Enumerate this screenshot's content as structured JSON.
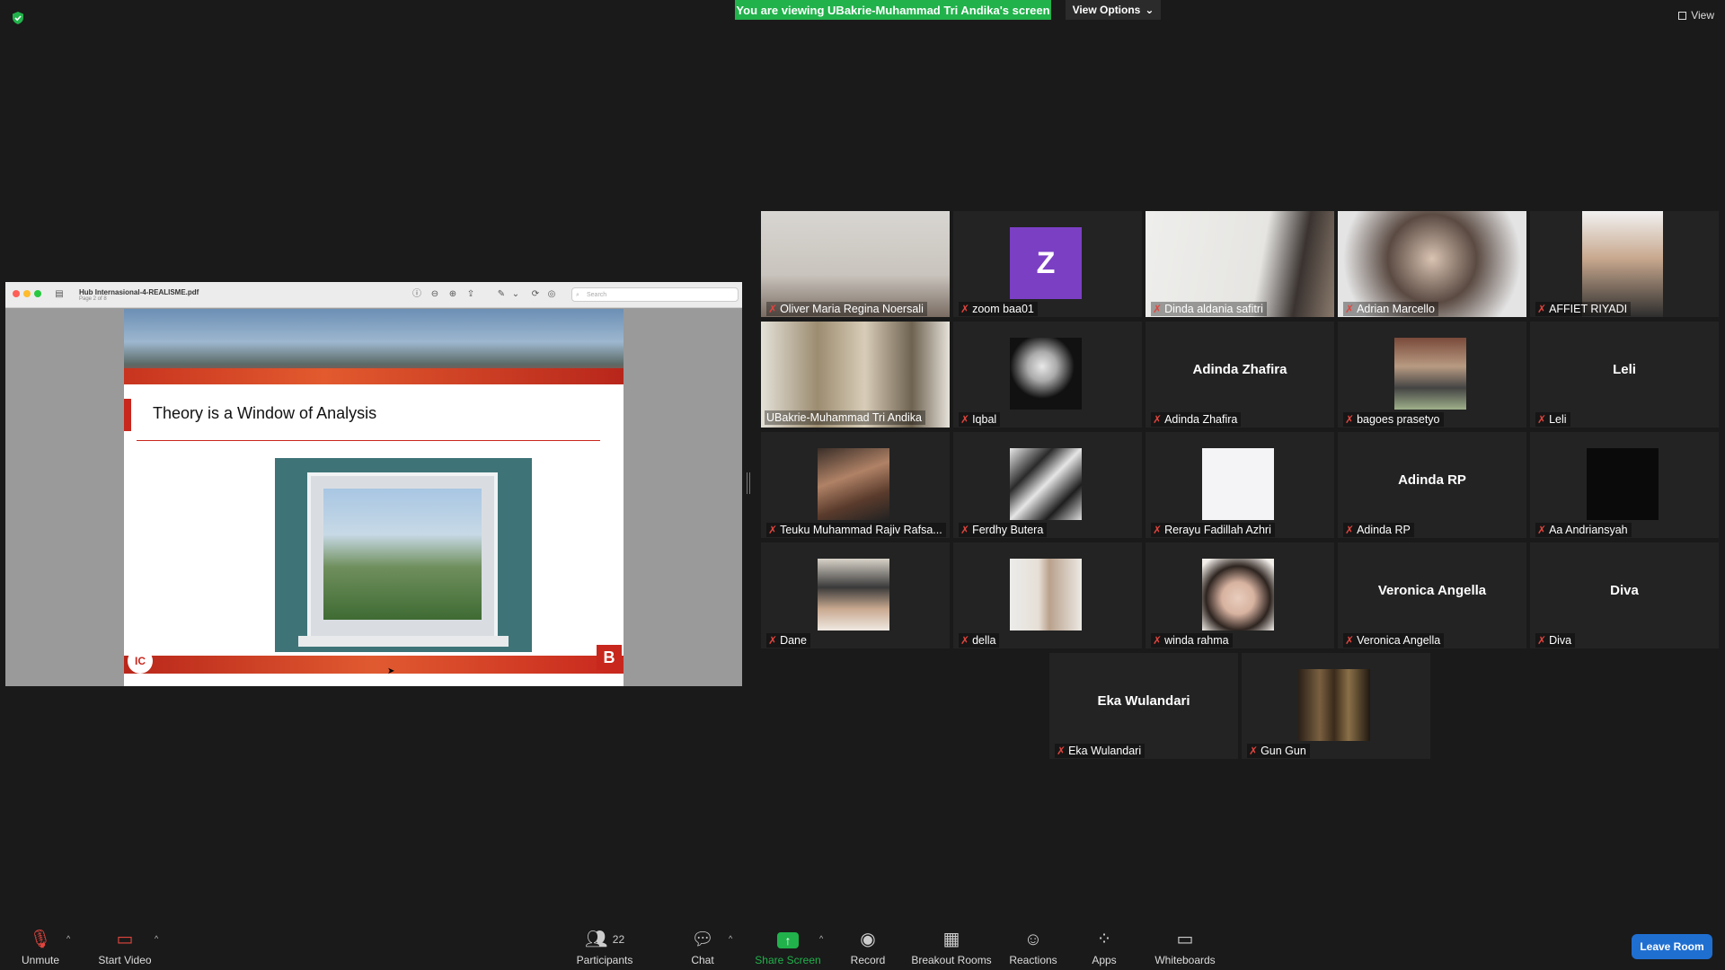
{
  "top": {
    "share_banner": "You are viewing UBakrie-Muhammad Tri Andika's screen",
    "view_options": "View Options",
    "view_toggle": "View"
  },
  "shared_screen": {
    "pdf_title": "Hub Internasional-4-REALISME.pdf",
    "pdf_subtitle": "Page 2 of 8",
    "search_placeholder": "Search",
    "slide_title": "Theory is a Window of Analysis",
    "slide_logo_left": "IC",
    "slide_logo_right": "B"
  },
  "participants": [
    {
      "name": "Oliver Maria Regina Noersali",
      "muted": true,
      "display": "video"
    },
    {
      "name": "zoom baa01",
      "muted": true,
      "display": "avatar",
      "avatar_letter": "Z"
    },
    {
      "name": "Dinda aldania safitri",
      "muted": true,
      "display": "video"
    },
    {
      "name": "Adrian Marcello",
      "muted": true,
      "display": "video"
    },
    {
      "name": "AFFIET RIYADI",
      "muted": true,
      "display": "video"
    },
    {
      "name": "UBakrie-Muhammad Tri Andika",
      "muted": false,
      "display": "video",
      "active_speaker": true
    },
    {
      "name": "Iqbal",
      "muted": true,
      "display": "photo"
    },
    {
      "name": "Adinda Zhafira",
      "muted": true,
      "display": "name"
    },
    {
      "name": "bagoes prasetyo",
      "muted": true,
      "display": "photo"
    },
    {
      "name": "Leli",
      "muted": true,
      "display": "name"
    },
    {
      "name": "Teuku Muhammad Rajiv Rafsa...",
      "muted": true,
      "display": "photo"
    },
    {
      "name": "Ferdhy Butera",
      "muted": true,
      "display": "photo"
    },
    {
      "name": "Rerayu Fadillah Azhri",
      "muted": true,
      "display": "photo"
    },
    {
      "name": "Adinda RP",
      "muted": true,
      "display": "name"
    },
    {
      "name": "Aa Andriansyah",
      "muted": true,
      "display": "photo"
    },
    {
      "name": "Dane",
      "muted": true,
      "display": "photo"
    },
    {
      "name": "della",
      "muted": true,
      "display": "photo"
    },
    {
      "name": "winda rahma",
      "muted": true,
      "display": "photo"
    },
    {
      "name": "Veronica Angella",
      "muted": true,
      "display": "name"
    },
    {
      "name": "Diva",
      "muted": true,
      "display": "name"
    },
    {
      "name": "Eka Wulandari",
      "muted": true,
      "display": "name"
    },
    {
      "name": "Gun Gun",
      "muted": true,
      "display": "photo"
    }
  ],
  "toolbar": {
    "unmute": "Unmute",
    "start_video": "Start Video",
    "participants": "Participants",
    "participants_count": "22",
    "chat": "Chat",
    "share_screen": "Share Screen",
    "record": "Record",
    "breakout_rooms": "Breakout Rooms",
    "reactions": "Reactions",
    "apps": "Apps",
    "whiteboards": "Whiteboards",
    "leave_room": "Leave Room"
  },
  "colors": {
    "share_banner": "#21b24b",
    "active_speaker": "#e3d54a",
    "leave_button": "#1f6fd1",
    "mute_icon": "#e0453e"
  }
}
